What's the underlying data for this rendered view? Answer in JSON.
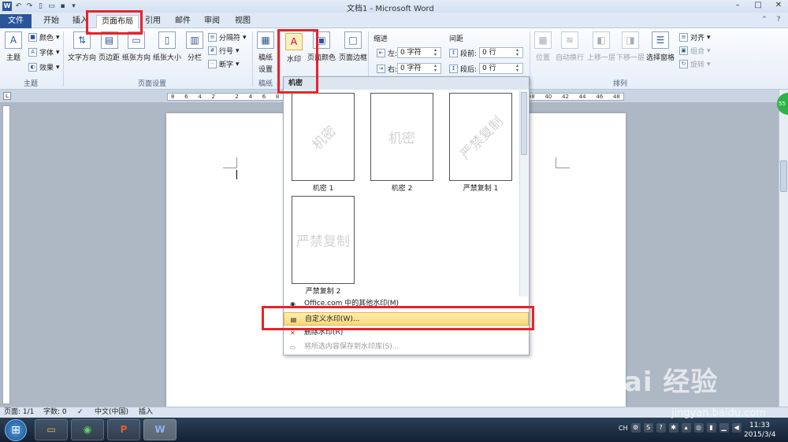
{
  "window": {
    "title": "文档1 - Microsoft Word",
    "app_icon": "W"
  },
  "tabs": [
    "文件",
    "开始",
    "插入",
    "页面布局",
    "引用",
    "邮件",
    "审阅",
    "视图"
  ],
  "ribbon": {
    "theme": {
      "label": "主题",
      "colors": "颜色",
      "fonts": "字体",
      "effects": "效果",
      "group": "主题"
    },
    "page_setup": {
      "direction": "文字方向",
      "margins": "页边距",
      "orientation": "纸张方向",
      "size": "纸张大小",
      "columns": "分栏",
      "breaks": "分隔符",
      "line_numbers": "行号",
      "hyphenation": "断字",
      "group": "页面设置"
    },
    "draft": {
      "label1": "稿纸",
      "label2": "设置",
      "group": "稿纸"
    },
    "background": {
      "watermark": "水印",
      "page_color": "页面颜色",
      "page_border": "页面边框"
    },
    "indent": {
      "title": "缩进",
      "left_label": "左:",
      "left_value": "0 字符",
      "right_label": "右:",
      "right_value": "0 字符"
    },
    "spacing": {
      "title": "间距",
      "before_label": "段前:",
      "before_value": "0 行",
      "after_label": "段后:",
      "after_value": "0 行"
    },
    "arrange": {
      "position": "位置",
      "wrap": "自动换行",
      "forward": "上移一层",
      "backward": "下移一层",
      "selection_pane": "选择窗格",
      "align": "对齐",
      "group_btn": "组合",
      "rotate": "旋转",
      "group": "排列"
    }
  },
  "ruler": {
    "labels": [
      "8",
      "6",
      "4",
      "2",
      "",
      "2",
      "4",
      "6",
      "8",
      "10",
      "12",
      "14",
      "16",
      "18",
      "20",
      "22",
      "24",
      "26",
      "28",
      "30",
      "32",
      "34",
      "36",
      "38",
      "40",
      "42",
      "44",
      "46",
      "48"
    ]
  },
  "watermark_dropdown": {
    "section": "机密",
    "items": [
      {
        "label": "机密 1",
        "text": "机密"
      },
      {
        "label": "机密 2",
        "text": "机密"
      },
      {
        "label": "严禁复制 1",
        "text": "严禁复制"
      },
      {
        "label": "严禁复制 2",
        "text": "严禁复制"
      }
    ],
    "menu": {
      "office": "Office.com 中的其他水印(M)",
      "custom": "自定义水印(W)...",
      "remove": "删除水印(R)",
      "save": "将所选内容保存到水印库(S)..."
    }
  },
  "status": {
    "page": "页面: 1/1",
    "words": "字数: 0",
    "language": "中文(中国)",
    "mode": "插入"
  },
  "taskbar": {
    "time": "11:33",
    "date": "2015/3/4",
    "ime": "CH"
  },
  "overlay": {
    "watermark": "Bai 经验",
    "url": "jingyan.baidu.com",
    "green_badge": "55"
  },
  "colors": {
    "accent": "#2a5699",
    "highlight": "#e8232a",
    "menu_hover": "#fad878"
  }
}
